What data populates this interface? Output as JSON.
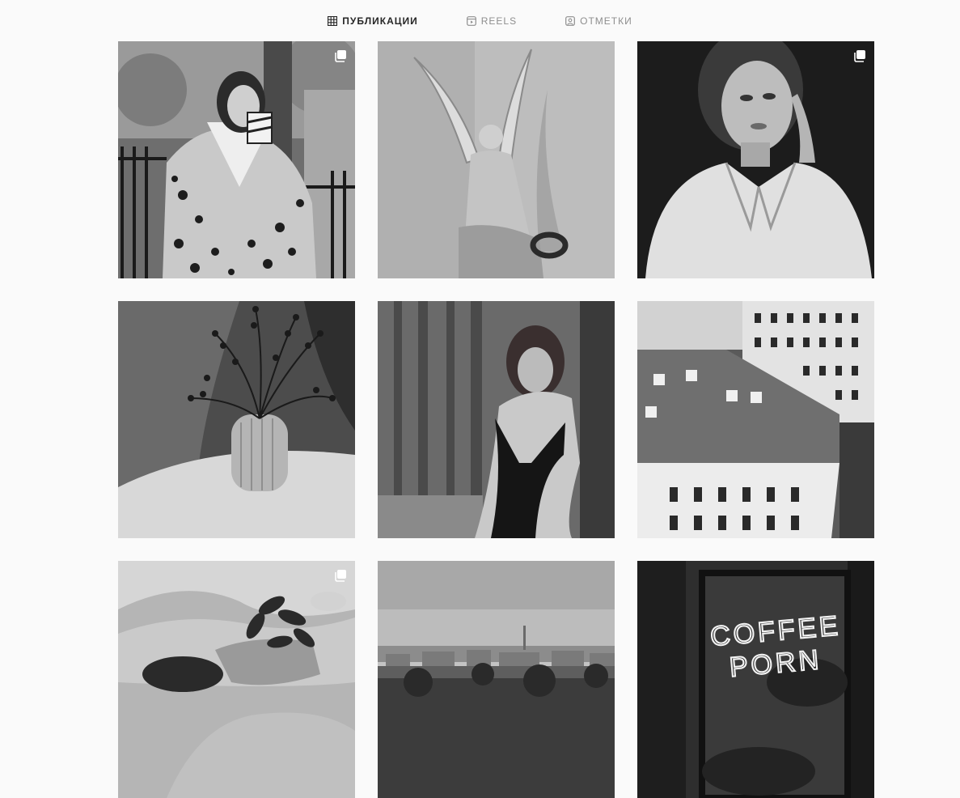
{
  "tabs": [
    {
      "label": "ПУБЛИКАЦИИ",
      "icon": "grid-icon",
      "active": true
    },
    {
      "label": "REELS",
      "icon": "reels-icon",
      "active": false
    },
    {
      "label": "ОТМЕТКИ",
      "icon": "tagged-icon",
      "active": false
    }
  ],
  "posts": [
    {
      "subject": "woman in leopard coat with cup by fence",
      "multi": true
    },
    {
      "subject": "angel statue with wreath",
      "multi": false
    },
    {
      "subject": "woman in white shirt portrait",
      "multi": true
    },
    {
      "subject": "vase with berry branches",
      "multi": false
    },
    {
      "subject": "woman in black swimsuit by curtain",
      "multi": false
    },
    {
      "subject": "rooftops of city buildings",
      "multi": false
    },
    {
      "subject": "woman lying with flowers",
      "multi": true
    },
    {
      "subject": "city skyline panorama",
      "multi": false
    },
    {
      "subject": "neon sign window",
      "multi": false,
      "neon_text": [
        "COFFEE",
        "PORN"
      ]
    }
  ]
}
